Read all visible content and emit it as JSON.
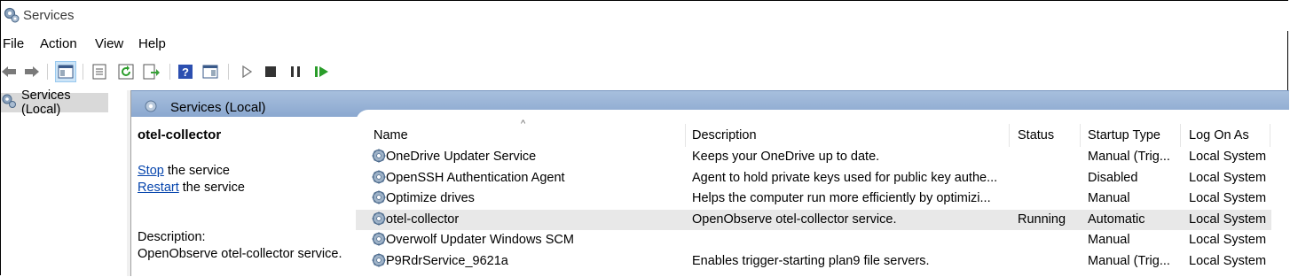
{
  "window": {
    "title": "Services"
  },
  "menu": [
    "File",
    "Action",
    "View",
    "Help"
  ],
  "toolbar": {
    "buttons": [
      "back-icon",
      "forward-icon",
      "show-hide-console-tree-icon",
      "properties-icon",
      "refresh-icon",
      "export-list-icon",
      "help-icon",
      "show-hide-action-pane-icon",
      "start-service-icon",
      "stop-service-icon",
      "pause-service-icon",
      "restart-service-icon"
    ]
  },
  "tree": {
    "root_label": "Services (Local)"
  },
  "panel": {
    "title": "Services (Local)"
  },
  "details": {
    "service_name": "otel-collector",
    "stop_link": "Stop",
    "stop_text": " the service",
    "restart_link": "Restart",
    "restart_text": " the service",
    "description_label": "Description:",
    "description": "OpenObserve otel-collector service."
  },
  "columns": [
    "Name",
    "Description",
    "Status",
    "Startup Type",
    "Log On As"
  ],
  "rows": [
    {
      "name": "OneDrive Updater Service",
      "description": "Keeps your OneDrive up to date.",
      "status": "",
      "startup": "Manual (Trig...",
      "logon": "Local System"
    },
    {
      "name": "OpenSSH Authentication Agent",
      "description": "Agent to hold private keys used for public key authe...",
      "status": "",
      "startup": "Disabled",
      "logon": "Local System"
    },
    {
      "name": "Optimize drives",
      "description": "Helps the computer run more efficiently by optimizi...",
      "status": "",
      "startup": "Manual",
      "logon": "Local System"
    },
    {
      "name": "otel-collector",
      "description": "OpenObserve otel-collector service.",
      "status": "Running",
      "startup": "Automatic",
      "logon": "Local System"
    },
    {
      "name": "Overwolf Updater Windows SCM",
      "description": "",
      "status": "",
      "startup": "Manual",
      "logon": "Local System"
    },
    {
      "name": "P9RdrService_9621a",
      "description": "Enables trigger-starting plan9 file servers.",
      "status": "",
      "startup": "Manual (Trig...",
      "logon": "Local System"
    }
  ],
  "selected_row_index": 3,
  "colors": {
    "header_band": "#9db6d8",
    "selected_row": "#e8e8e8",
    "link": "#0645ad"
  }
}
